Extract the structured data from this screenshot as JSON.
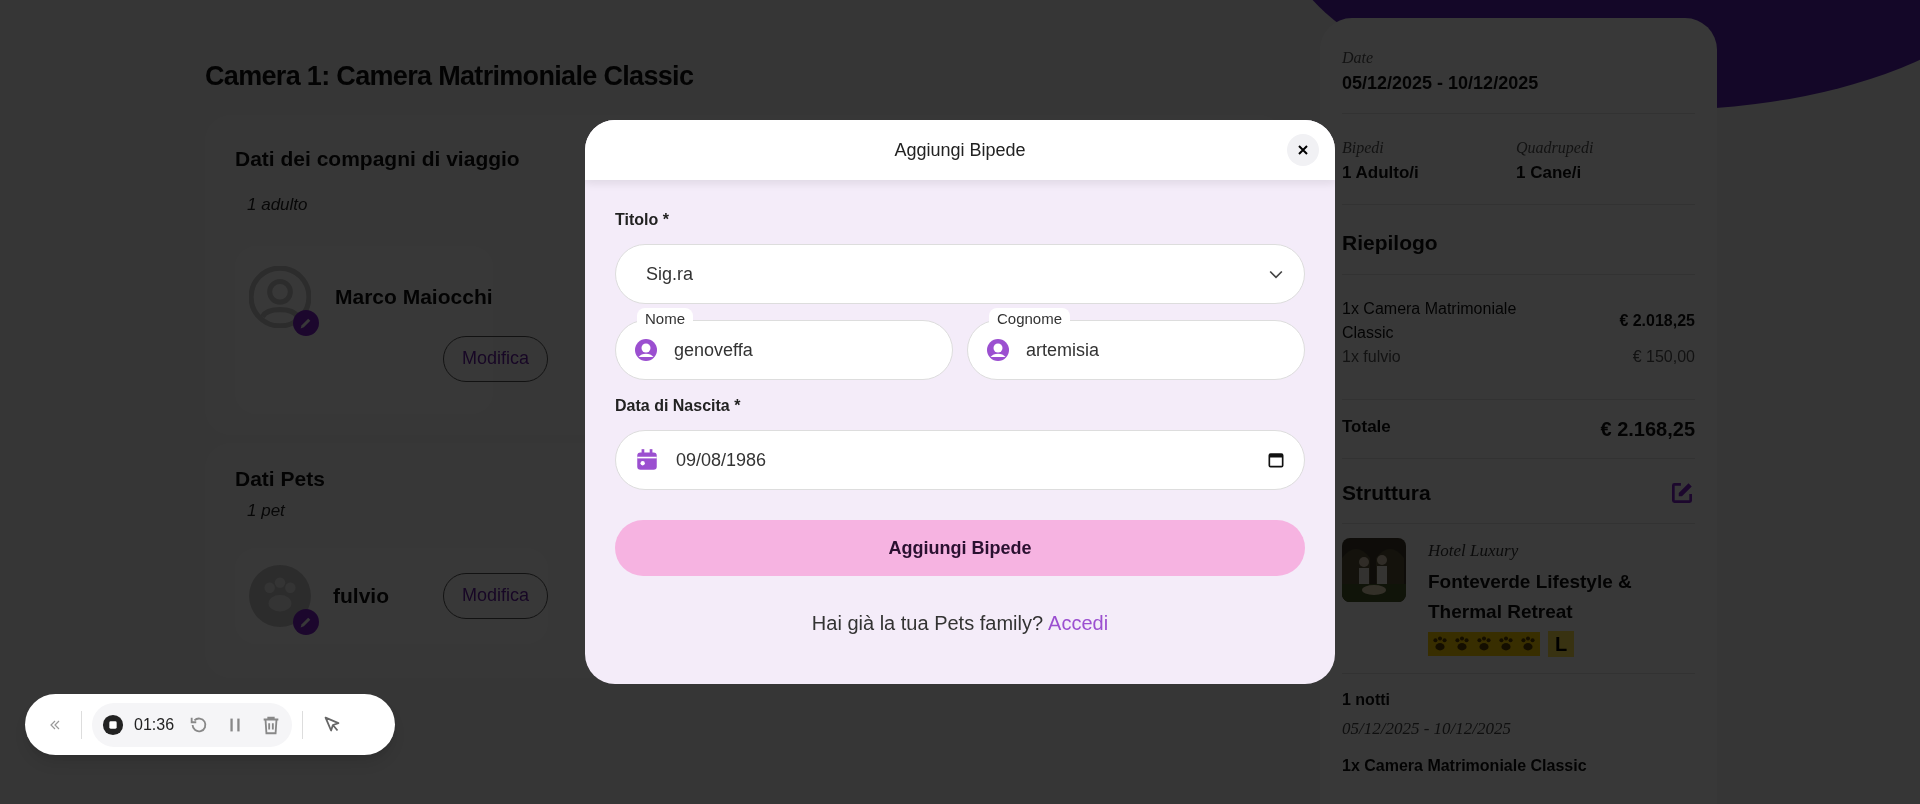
{
  "page": {
    "room_heading": "Camera 1: Camera Matrimoniale Classic",
    "travelers": {
      "title": "Dati dei compagni di viaggio",
      "count": "1 adulto",
      "people": [
        {
          "name": "Marco Maiocchi",
          "button": "Modifica"
        }
      ]
    },
    "pets": {
      "title": "Dati Pets",
      "count": "1 pet",
      "pets": [
        {
          "name": "fulvio",
          "button": "Modifica"
        }
      ]
    }
  },
  "summary": {
    "date_label": "Date",
    "date_value": "05/12/2025 - 10/12/2025",
    "guests": [
      {
        "label": "Bipedi",
        "value": "1 Adulto/i"
      },
      {
        "label": "Quadrupedi",
        "value": "1 Cane/i"
      }
    ],
    "recap_title": "Riepilogo",
    "lines": [
      {
        "kind": "main",
        "label": "1x Camera Matrimoniale Classic",
        "amount": "€ 2.018,25"
      },
      {
        "kind": "extra",
        "label": "1x fulvio",
        "amount": "€ 150,00"
      }
    ],
    "total_label": "Totale",
    "total": "€ 2.168,25",
    "structure_title": "Struttura",
    "hotel": {
      "category": "Hotel Luxury",
      "name": "Fonteverde Lifestyle & Thermal Retreat",
      "stars": 5,
      "badge": "L"
    },
    "stay": {
      "nights": "1 notti",
      "dates": "05/12/2025 - 10/12/2025",
      "room": "1x Camera Matrimoniale Classic"
    }
  },
  "modal": {
    "title": "Aggiungi Bipede",
    "fields": [
      {
        "kind": "select",
        "label": "Titolo *",
        "value": "Sig.ra"
      },
      {
        "kind": "text",
        "label": "Nome",
        "value": "genoveffa"
      },
      {
        "kind": "text",
        "label": "Cognome",
        "value": "artemisia"
      },
      {
        "kind": "date",
        "label": "Data di Nascita *",
        "value": "09/08/1986"
      }
    ],
    "submit": "Aggiungi Bipede",
    "login_prompt": "Hai già la tua Pets family?",
    "login_link": "Accedi"
  },
  "recorder": {
    "time": "01:36"
  }
}
